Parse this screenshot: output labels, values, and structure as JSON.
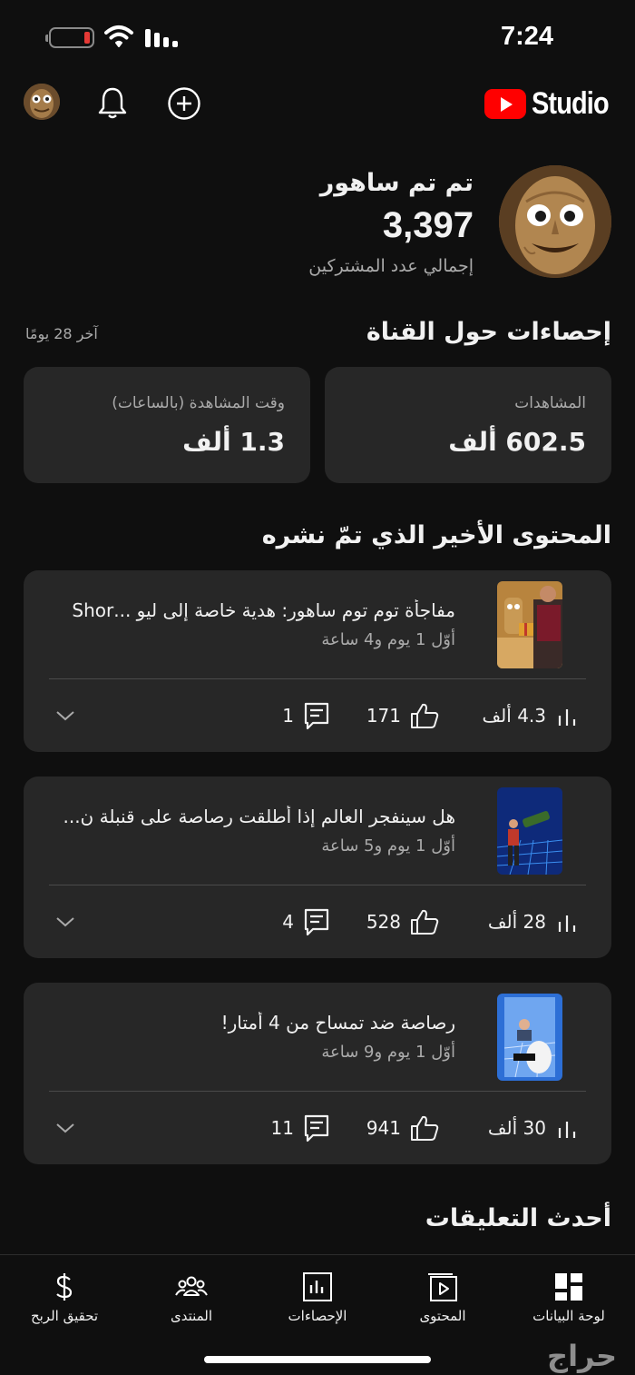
{
  "status_bar": {
    "time": "7:24"
  },
  "header": {
    "logo_text": "Studio"
  },
  "channel": {
    "name": "تم تم ساهور",
    "subscribers": "3,397",
    "subscribers_label": "إجمالي عدد المشتركين"
  },
  "analytics": {
    "title": "إحصاءات حول القناة",
    "period": "آخر 28 يومًا",
    "views_label": "المشاهدات",
    "views_value": "602.5 ألف",
    "watch_label": "وقت المشاهدة (بالساعات)",
    "watch_value": "1.3 ألف"
  },
  "recent": {
    "title": "المحتوى الأخير الذي تمّ نشره",
    "videos": [
      {
        "title": "مفاجأة توم توم ساهور: هدية خاصة إلى ليو ...Shor",
        "age": "أوّل 1 يوم و4 ساعة",
        "views": "4.3 ألف",
        "likes": "171",
        "comments": "1"
      },
      {
        "title": "هل سينفجر العالم إذا أطلقت رصاصة على قنبلة ن...",
        "age": "أوّل 1 يوم و5 ساعة",
        "views": "28 ألف",
        "likes": "528",
        "comments": "4"
      },
      {
        "title": "رصاصة ضد تمساح من 4 أمتار!",
        "age": "أوّل 1 يوم و9 ساعة",
        "views": "30 ألف",
        "likes": "941",
        "comments": "11"
      }
    ]
  },
  "comments_section": {
    "title": "أحدث التعليقات"
  },
  "bottom_nav": {
    "dashboard": "لوحة البيانات",
    "content": "المحتوى",
    "analytics": "الإحصاءات",
    "community": "المنتدى",
    "earn": "تحقيق الربح"
  },
  "watermark": "حراج",
  "colors": {
    "background": "#0f0f0f",
    "card": "#272727",
    "brand_red": "#ff0000",
    "secondary_text": "#aaaaaa"
  }
}
